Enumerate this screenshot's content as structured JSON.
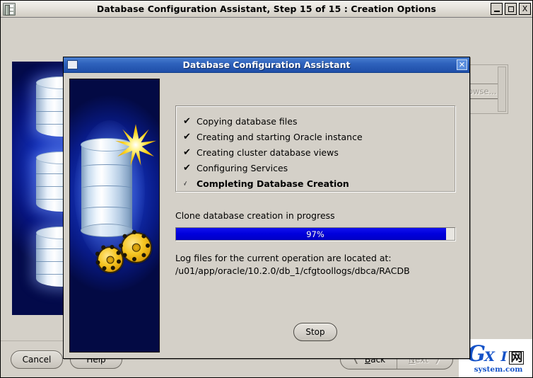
{
  "outer_window": {
    "title": "Database Configuration Assistant, Step 15 of 15 : Creation Options",
    "app_icon": "database-icon",
    "minimize_label": "_",
    "maximize_label": "□",
    "close_label": "X"
  },
  "background_window": {
    "browse_label": "Browse...",
    "splash_alt": "oracle-database-splash"
  },
  "dialog": {
    "title": "Database Configuration Assistant",
    "icon": "window-icon",
    "close_label": "✕",
    "splash_alt": "oracle-database-gears-splash",
    "checklist": [
      {
        "mark": "✔",
        "label": "Copying database files",
        "state": "done"
      },
      {
        "mark": "✔",
        "label": "Creating and starting Oracle instance",
        "state": "done"
      },
      {
        "mark": "✔",
        "label": "Creating cluster database views",
        "state": "done"
      },
      {
        "mark": "✔",
        "label": "Configuring Services",
        "state": "done"
      },
      {
        "mark": "✔",
        "label": "Completing Database Creation",
        "state": "current"
      }
    ],
    "status_text": "Clone database creation in progress",
    "progress": {
      "percent": 97,
      "label": "97%",
      "fill_color": "#0000dd"
    },
    "log_line_1": "Log files for the current operation are located at:",
    "log_line_2": "/u01/app/oracle/10.2.0/db_1/cfgtoollogs/dbca/RACDB",
    "stop_label": "Stop"
  },
  "bottom_bar": {
    "cancel_label": "Cancel",
    "help_label": "Help",
    "back_label": "Back",
    "back_chevron": "❬",
    "next_label": "Next",
    "next_chevron": "❭"
  },
  "watermark": {
    "g": "G",
    "xi": "X I",
    "cn": "网",
    "domain": "system.com",
    "color": "#1452c8"
  }
}
